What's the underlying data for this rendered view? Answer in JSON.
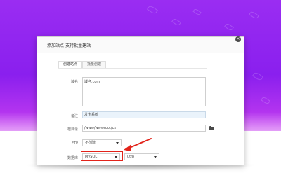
{
  "dialog": {
    "title": "添加站点-支持批量建站",
    "close_icon": "close-icon"
  },
  "tabs": [
    {
      "label": "创建站点"
    },
    {
      "label": "批量创建"
    }
  ],
  "form": {
    "domain_label": "域名",
    "domain_value": "域名.com",
    "note_label": "备注",
    "note_value": "发卡系统",
    "root_label": "根目录",
    "root_value": "/www/wwwroot/cs",
    "ftp_label": "FTP",
    "ftp_value": "不创建",
    "db_label": "数据库",
    "db_value": "MySQL",
    "db_charset_value": "utf8"
  },
  "colors": {
    "accent": "#e2231a"
  }
}
